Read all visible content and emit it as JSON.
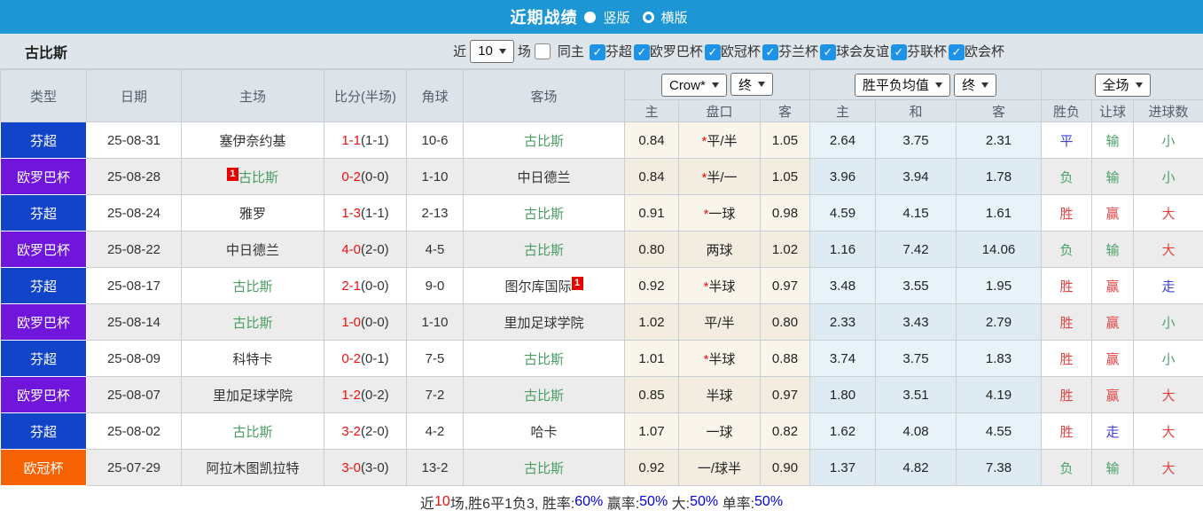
{
  "nav": {
    "title": "近期战绩",
    "radios": [
      {
        "label": "竖版",
        "selected": true
      },
      {
        "label": "横版",
        "selected": false
      }
    ],
    "bar_color": "#1c96d4"
  },
  "filter": {
    "team": "古比斯",
    "near_label": "近",
    "matches_value": "10",
    "matches_label": "场",
    "same_home": {
      "label": "同主",
      "checked": false
    },
    "leagues": [
      {
        "label": "芬超",
        "checked": true
      },
      {
        "label": "欧罗巴杯",
        "checked": true
      },
      {
        "label": "欧冠杯",
        "checked": true
      },
      {
        "label": "芬兰杯",
        "checked": true
      },
      {
        "label": "球会友谊",
        "checked": true
      },
      {
        "label": "芬联杯",
        "checked": true
      },
      {
        "label": "欧会杯",
        "checked": true
      }
    ],
    "checkbox_color": "#1d93e8"
  },
  "table": {
    "main_headers": [
      "类型",
      "日期",
      "主场",
      "比分(半场)",
      "角球",
      "客场"
    ],
    "selects": [
      "Crow*",
      "终",
      "胜平负均值",
      "终",
      "全场"
    ],
    "sub_headers": [
      "主",
      "盘口",
      "客",
      "主",
      "和",
      "客",
      "胜负",
      "让球",
      "进球数"
    ],
    "type_colors": {
      "芬超": "#1144c8",
      "欧罗巴杯": "#6f15dc",
      "欧冠杯": "#f76205"
    },
    "result_colors": {
      "red": "#e24444",
      "green": "#4aa168",
      "blue": "#3f3fd8"
    },
    "self_team_color": "#4a9e63",
    "rows": [
      {
        "type": "芬超",
        "date": "25-08-31",
        "home": {
          "name": "塞伊奈约基",
          "self": false,
          "rank": null,
          "rank_pos": null
        },
        "score_full": "1-1",
        "score_half": "(1-1)",
        "corner": "10-6",
        "away": {
          "name": "古比斯",
          "self": true,
          "rank": null,
          "rank_pos": null
        },
        "odds_home": "0.84",
        "handicap": {
          "star": true,
          "text": "平/半"
        },
        "odds_away": "1.05",
        "avg": [
          "2.64",
          "3.75",
          "2.31"
        ],
        "results": [
          {
            "text": "平",
            "color": "blue"
          },
          {
            "text": "输",
            "color": "green"
          },
          {
            "text": "小",
            "color": "green"
          }
        ]
      },
      {
        "type": "欧罗巴杯",
        "date": "25-08-28",
        "home": {
          "name": "古比斯",
          "self": true,
          "rank": "1",
          "rank_pos": "before"
        },
        "score_full": "0-2",
        "score_half": "(0-0)",
        "corner": "1-10",
        "away": {
          "name": "中日德兰",
          "self": false,
          "rank": null,
          "rank_pos": null
        },
        "odds_home": "0.84",
        "handicap": {
          "star": true,
          "text": "半/一"
        },
        "odds_away": "1.05",
        "avg": [
          "3.96",
          "3.94",
          "1.78"
        ],
        "results": [
          {
            "text": "负",
            "color": "green"
          },
          {
            "text": "输",
            "color": "green"
          },
          {
            "text": "小",
            "color": "green"
          }
        ]
      },
      {
        "type": "芬超",
        "date": "25-08-24",
        "home": {
          "name": "雅罗",
          "self": false,
          "rank": null,
          "rank_pos": null
        },
        "score_full": "1-3",
        "score_half": "(1-1)",
        "corner": "2-13",
        "away": {
          "name": "古比斯",
          "self": true,
          "rank": null,
          "rank_pos": null
        },
        "odds_home": "0.91",
        "handicap": {
          "star": true,
          "text": "一球"
        },
        "odds_away": "0.98",
        "avg": [
          "4.59",
          "4.15",
          "1.61"
        ],
        "results": [
          {
            "text": "胜",
            "color": "red"
          },
          {
            "text": "赢",
            "color": "red"
          },
          {
            "text": "大",
            "color": "red"
          }
        ]
      },
      {
        "type": "欧罗巴杯",
        "date": "25-08-22",
        "home": {
          "name": "中日德兰",
          "self": false,
          "rank": null,
          "rank_pos": null
        },
        "score_full": "4-0",
        "score_half": "(2-0)",
        "corner": "4-5",
        "away": {
          "name": "古比斯",
          "self": true,
          "rank": null,
          "rank_pos": null
        },
        "odds_home": "0.80",
        "handicap": {
          "star": false,
          "text": "两球"
        },
        "odds_away": "1.02",
        "avg": [
          "1.16",
          "7.42",
          "14.06"
        ],
        "results": [
          {
            "text": "负",
            "color": "green"
          },
          {
            "text": "输",
            "color": "green"
          },
          {
            "text": "大",
            "color": "red"
          }
        ]
      },
      {
        "type": "芬超",
        "date": "25-08-17",
        "home": {
          "name": "古比斯",
          "self": true,
          "rank": null,
          "rank_pos": null
        },
        "score_full": "2-1",
        "score_half": "(0-0)",
        "corner": "9-0",
        "away": {
          "name": "图尔库国际",
          "self": false,
          "rank": "1",
          "rank_pos": "after"
        },
        "odds_home": "0.92",
        "handicap": {
          "star": true,
          "text": "半球"
        },
        "odds_away": "0.97",
        "avg": [
          "3.48",
          "3.55",
          "1.95"
        ],
        "results": [
          {
            "text": "胜",
            "color": "red"
          },
          {
            "text": "赢",
            "color": "red"
          },
          {
            "text": "走",
            "color": "blue"
          }
        ]
      },
      {
        "type": "欧罗巴杯",
        "date": "25-08-14",
        "home": {
          "name": "古比斯",
          "self": true,
          "rank": null,
          "rank_pos": null
        },
        "score_full": "1-0",
        "score_half": "(0-0)",
        "corner": "1-10",
        "away": {
          "name": "里加足球学院",
          "self": false,
          "rank": null,
          "rank_pos": null
        },
        "odds_home": "1.02",
        "handicap": {
          "star": false,
          "text": "平/半"
        },
        "odds_away": "0.80",
        "avg": [
          "2.33",
          "3.43",
          "2.79"
        ],
        "results": [
          {
            "text": "胜",
            "color": "red"
          },
          {
            "text": "赢",
            "color": "red"
          },
          {
            "text": "小",
            "color": "green"
          }
        ]
      },
      {
        "type": "芬超",
        "date": "25-08-09",
        "home": {
          "name": "科特卡",
          "self": false,
          "rank": null,
          "rank_pos": null
        },
        "score_full": "0-2",
        "score_half": "(0-1)",
        "corner": "7-5",
        "away": {
          "name": "古比斯",
          "self": true,
          "rank": null,
          "rank_pos": null
        },
        "odds_home": "1.01",
        "handicap": {
          "star": true,
          "text": "半球"
        },
        "odds_away": "0.88",
        "avg": [
          "3.74",
          "3.75",
          "1.83"
        ],
        "results": [
          {
            "text": "胜",
            "color": "red"
          },
          {
            "text": "赢",
            "color": "red"
          },
          {
            "text": "小",
            "color": "green"
          }
        ]
      },
      {
        "type": "欧罗巴杯",
        "date": "25-08-07",
        "home": {
          "name": "里加足球学院",
          "self": false,
          "rank": null,
          "rank_pos": null
        },
        "score_full": "1-2",
        "score_half": "(0-2)",
        "corner": "7-2",
        "away": {
          "name": "古比斯",
          "self": true,
          "rank": null,
          "rank_pos": null
        },
        "odds_home": "0.85",
        "handicap": {
          "star": false,
          "text": "半球"
        },
        "odds_away": "0.97",
        "avg": [
          "1.80",
          "3.51",
          "4.19"
        ],
        "results": [
          {
            "text": "胜",
            "color": "red"
          },
          {
            "text": "赢",
            "color": "red"
          },
          {
            "text": "大",
            "color": "red"
          }
        ]
      },
      {
        "type": "芬超",
        "date": "25-08-02",
        "home": {
          "name": "古比斯",
          "self": true,
          "rank": null,
          "rank_pos": null
        },
        "score_full": "3-2",
        "score_half": "(2-0)",
        "corner": "4-2",
        "away": {
          "name": "哈卡",
          "self": false,
          "rank": null,
          "rank_pos": null
        },
        "odds_home": "1.07",
        "handicap": {
          "star": false,
          "text": "一球"
        },
        "odds_away": "0.82",
        "avg": [
          "1.62",
          "4.08",
          "4.55"
        ],
        "results": [
          {
            "text": "胜",
            "color": "red"
          },
          {
            "text": "走",
            "color": "blue"
          },
          {
            "text": "大",
            "color": "red"
          }
        ]
      },
      {
        "type": "欧冠杯",
        "date": "25-07-29",
        "home": {
          "name": "阿拉木图凯拉特",
          "self": false,
          "rank": null,
          "rank_pos": null
        },
        "score_full": "3-0",
        "score_half": "(3-0)",
        "corner": "13-2",
        "away": {
          "name": "古比斯",
          "self": true,
          "rank": null,
          "rank_pos": null
        },
        "odds_home": "0.92",
        "handicap": {
          "star": false,
          "text": "一/球半"
        },
        "odds_away": "0.90",
        "avg": [
          "1.37",
          "4.82",
          "7.38"
        ],
        "results": [
          {
            "text": "负",
            "color": "green"
          },
          {
            "text": "输",
            "color": "green"
          },
          {
            "text": "大",
            "color": "red"
          }
        ]
      }
    ]
  },
  "summary": {
    "parts": [
      {
        "text": "近",
        "color": "#333333"
      },
      {
        "text": "10",
        "color": "#ee1111"
      },
      {
        "text": "场,胜6平1负3, 胜率:",
        "color": "#333333"
      },
      {
        "text": "60%",
        "color": "#0000e0"
      },
      {
        "text": " 赢率:",
        "color": "#333333"
      },
      {
        "text": "50%",
        "color": "#0000e0"
      },
      {
        "text": " 大:",
        "color": "#333333"
      },
      {
        "text": "50%",
        "color": "#0000e0"
      },
      {
        "text": " 单率:",
        "color": "#333333"
      },
      {
        "text": "50%",
        "color": "#0000e0"
      }
    ]
  }
}
